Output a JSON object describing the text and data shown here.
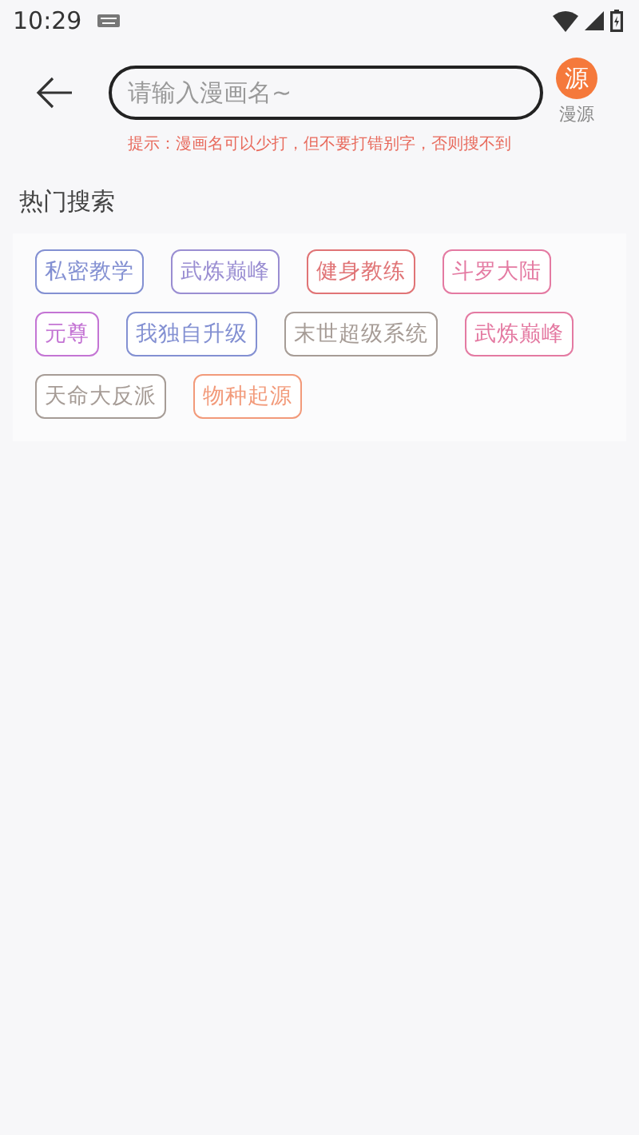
{
  "status_bar": {
    "time": "10:29"
  },
  "search": {
    "placeholder": "请输入漫画名~"
  },
  "source_button": {
    "icon_text": "源",
    "label": "漫源"
  },
  "hint": "提示：漫画名可以少打，但不要打错别字，否则搜不到",
  "hot_search": {
    "title": "热门搜索",
    "tags": [
      {
        "label": "私密教学",
        "color": "#8390d2"
      },
      {
        "label": "武炼巅峰",
        "color": "#9a8ed2"
      },
      {
        "label": "健身教练",
        "color": "#e07476"
      },
      {
        "label": "斗罗大陆",
        "color": "#e47aa2"
      },
      {
        "label": "元尊",
        "color": "#c475d4"
      },
      {
        "label": "我独自升级",
        "color": "#8390d2"
      },
      {
        "label": "末世超级系统",
        "color": "#a69c96"
      },
      {
        "label": "武炼巅峰",
        "color": "#e47aa2"
      },
      {
        "label": "天命大反派",
        "color": "#a69c96"
      },
      {
        "label": "物种起源",
        "color": "#f29a7a"
      }
    ]
  }
}
